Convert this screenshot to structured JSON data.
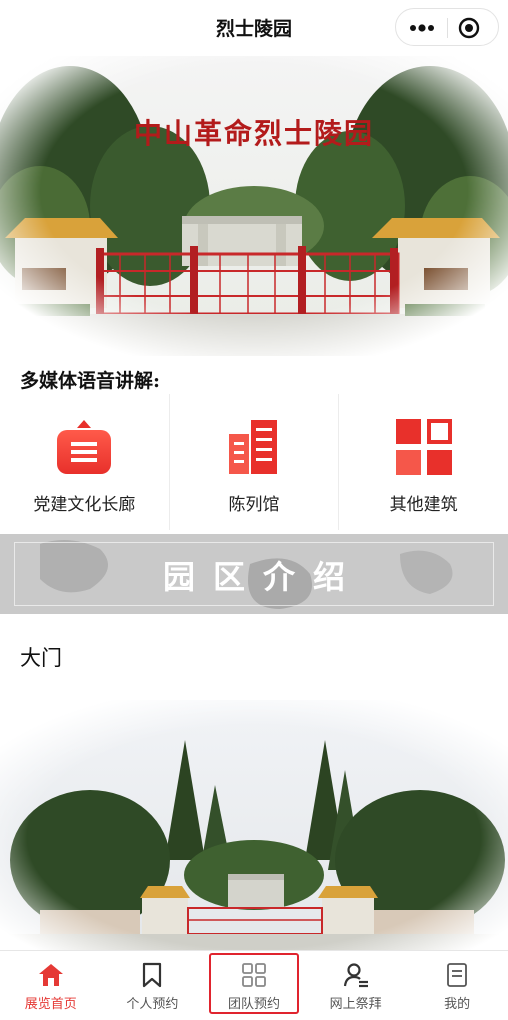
{
  "navbar": {
    "title": "烈士陵园"
  },
  "hero": {
    "title": "中山革命烈士陵园"
  },
  "section": {
    "heading": "多媒体语音讲解:"
  },
  "categories": [
    {
      "label": "党建文化长廊",
      "icon": "briefcase-icon"
    },
    {
      "label": "陈列馆",
      "icon": "building-icon"
    },
    {
      "label": "其他建筑",
      "icon": "grid-icon"
    }
  ],
  "banner": {
    "text": "园区介绍"
  },
  "spot": {
    "title": "大门"
  },
  "tabbar": {
    "items": [
      {
        "label": "展览首页",
        "icon": "home-icon",
        "active": true
      },
      {
        "label": "个人预约",
        "icon": "bookmark-icon"
      },
      {
        "label": "团队预约",
        "icon": "apps-icon"
      },
      {
        "label": "网上祭拜",
        "icon": "person-icon"
      },
      {
        "label": "我的",
        "icon": "document-icon"
      }
    ]
  },
  "colors": {
    "accent": "#e53935",
    "gate_red": "#c8282a",
    "banner_bg": "#c9c9c9"
  }
}
